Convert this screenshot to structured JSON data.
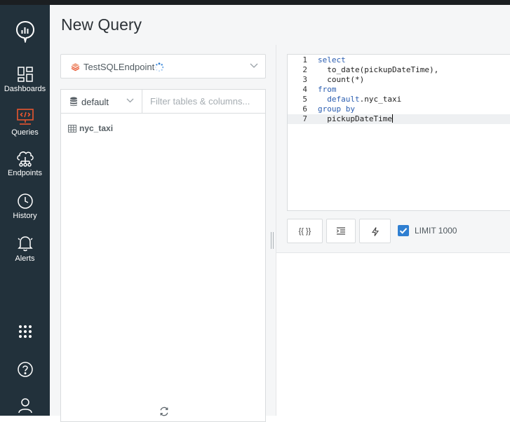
{
  "page": {
    "title": "New Query"
  },
  "sidebar": {
    "items": [
      {
        "id": "dashboards",
        "label": "Dashboards",
        "icon": "dashboards-icon"
      },
      {
        "id": "queries",
        "label": "Queries",
        "icon": "queries-icon",
        "active": true
      },
      {
        "id": "endpoints",
        "label": "Endpoints",
        "icon": "endpoints-icon"
      },
      {
        "id": "history",
        "label": "History",
        "icon": "history-icon"
      },
      {
        "id": "alerts",
        "label": "Alerts",
        "icon": "bell-icon"
      }
    ],
    "accent_color": "#e8552f"
  },
  "endpoint": {
    "name": "TestSQLEndpoint",
    "loading": true
  },
  "schema": {
    "selected": "default",
    "filter_placeholder": "Filter tables & columns...",
    "tables": [
      "nyc_taxi"
    ]
  },
  "editor": {
    "lines": [
      {
        "n": "1",
        "parts": [
          [
            "kw",
            "select"
          ]
        ]
      },
      {
        "n": "2",
        "parts": [
          [
            "fn",
            "  to_date(pickupDateTime),"
          ]
        ]
      },
      {
        "n": "3",
        "parts": [
          [
            "fn",
            "  count(*)"
          ]
        ]
      },
      {
        "n": "4",
        "parts": [
          [
            "kw",
            "from"
          ]
        ]
      },
      {
        "n": "5",
        "parts": [
          [
            "kw",
            "  default"
          ],
          [
            "fn",
            ".nyc_taxi"
          ]
        ]
      },
      {
        "n": "6",
        "parts": [
          [
            "kw",
            "group by"
          ]
        ]
      },
      {
        "n": "7",
        "parts": [
          [
            "fn",
            "  pickupDateTime"
          ]
        ],
        "active": true
      }
    ]
  },
  "toolbar": {
    "params_label": "{{ }}",
    "limit_label": "LIMIT 1000",
    "limit_checked": true,
    "checkbox_color": "#2f7fd1"
  }
}
